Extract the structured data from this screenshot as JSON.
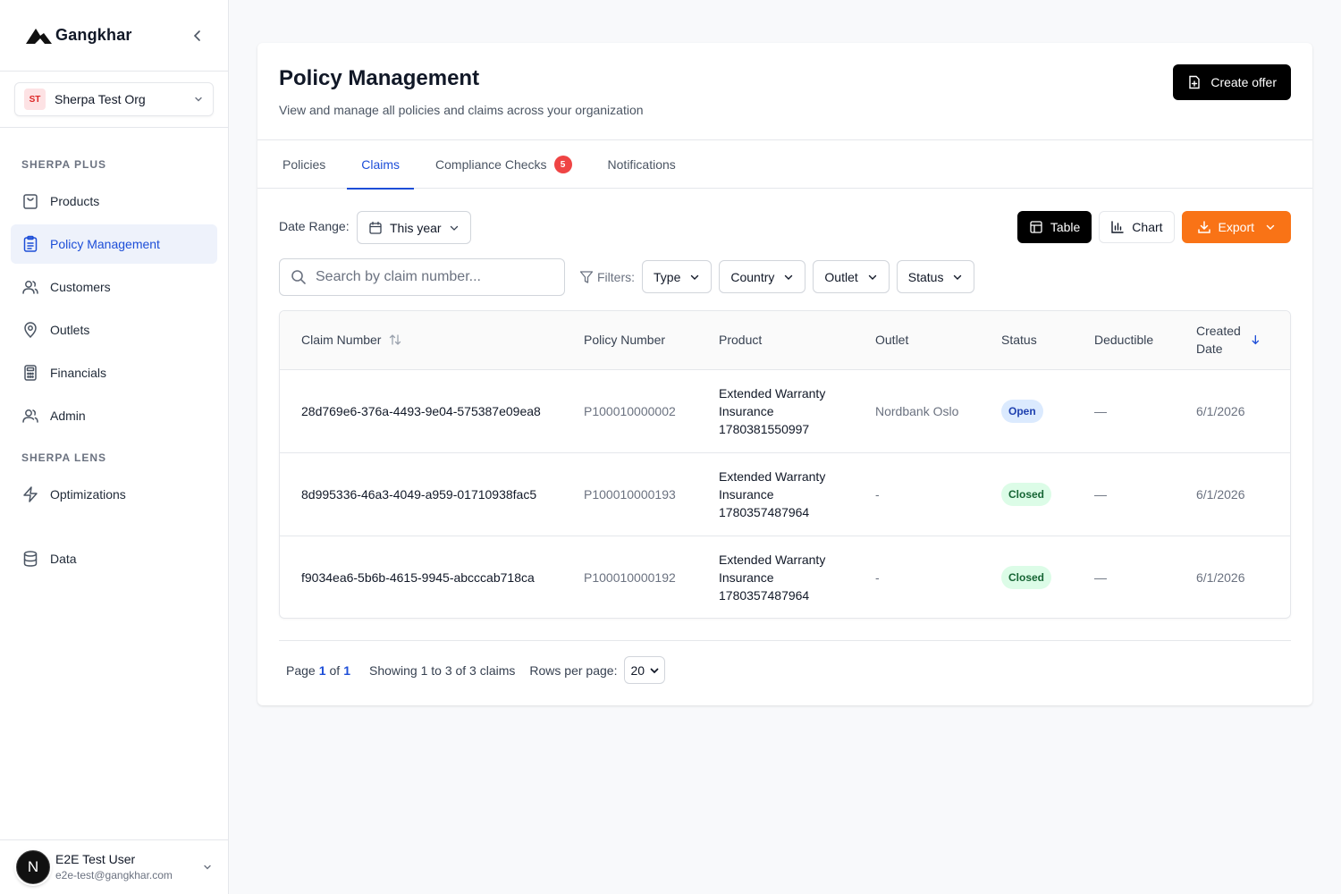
{
  "brand": {
    "name": "Gangkhar"
  },
  "org": {
    "initials": "ST",
    "name": "Sherpa Test Org"
  },
  "sidebar": {
    "sections": [
      {
        "title": "SHERPA PLUS"
      },
      {
        "title": "SHERPA LENS"
      }
    ],
    "items": [
      {
        "label": "Products",
        "icon": "shopping-bag-icon"
      },
      {
        "label": "Policy Management",
        "icon": "clipboard-icon",
        "active": true
      },
      {
        "label": "Customers",
        "icon": "users-icon"
      },
      {
        "label": "Outlets",
        "icon": "map-pin-icon"
      },
      {
        "label": "Financials",
        "icon": "calculator-icon"
      },
      {
        "label": "Admin",
        "icon": "user-cog-icon"
      },
      {
        "label": "Optimizations",
        "icon": "lightning-icon"
      },
      {
        "label": "Data",
        "icon": "database-icon"
      }
    ]
  },
  "user": {
    "initial": "N",
    "name": "E2E Test User",
    "email": "e2e-test@gangkhar.com"
  },
  "header": {
    "title": "Policy Management",
    "subtitle": "View and manage all policies and claims across your organization",
    "create_label": "Create offer"
  },
  "tabs": [
    {
      "label": "Policies"
    },
    {
      "label": "Claims",
      "active": true
    },
    {
      "label": "Compliance Checks",
      "badge": "5"
    },
    {
      "label": "Notifications"
    }
  ],
  "toolbar": {
    "date_label": "Date Range:",
    "date_value": "This year",
    "table_label": "Table",
    "chart_label": "Chart",
    "export_label": "Export",
    "export_color": "#f97316"
  },
  "search": {
    "placeholder": "Search by claim number...",
    "value": ""
  },
  "filters": {
    "label": "Filters:",
    "items": [
      "Type",
      "Country",
      "Outlet",
      "Status"
    ]
  },
  "table": {
    "columns": [
      "Claim Number",
      "Policy Number",
      "Product",
      "Outlet",
      "Status",
      "Deductible",
      "Created Date"
    ],
    "rows": [
      {
        "claim": "28d769e6-376a-4493-9e04-575387e09ea8",
        "policy": "P100010000002",
        "product": "Extended Warranty Insurance 1780381550997",
        "outlet": "Nordbank Oslo",
        "status": "Open",
        "deductible": "—",
        "created": "6/1/2026"
      },
      {
        "claim": "8d995336-46a3-4049-a959-01710938fac5",
        "policy": "P100010000193",
        "product": "Extended Warranty Insurance 1780357487964",
        "outlet": "-",
        "status": "Closed",
        "deductible": "—",
        "created": "6/1/2026"
      },
      {
        "claim": "f9034ea6-5b6b-4615-9945-abcccab718ca",
        "policy": "P100010000192",
        "product": "Extended Warranty Insurance 1780357487964",
        "outlet": "-",
        "status": "Closed",
        "deductible": "—",
        "created": "6/1/2026"
      }
    ]
  },
  "pagination": {
    "page_word": "Page",
    "current": "1",
    "of_word": "of",
    "total": "1",
    "showing": "Showing 1 to 3 of 3 claims",
    "rows_label": "Rows per page:",
    "rows_value": "20"
  }
}
